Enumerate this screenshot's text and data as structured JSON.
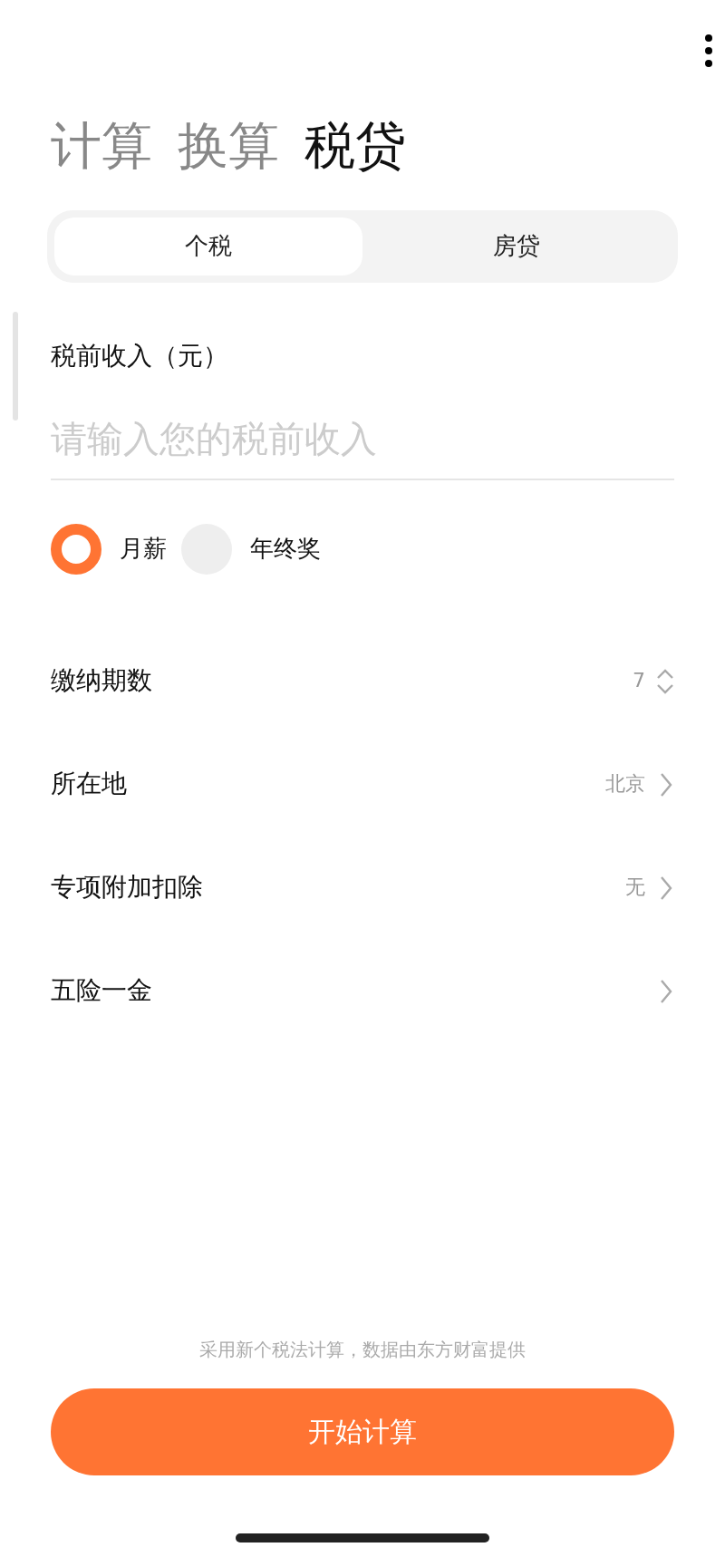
{
  "top_tabs": [
    {
      "label": "计算",
      "selected": false
    },
    {
      "label": "换算",
      "selected": false
    },
    {
      "label": "税贷",
      "selected": true
    }
  ],
  "segments": [
    {
      "label": "个税",
      "selected": true
    },
    {
      "label": "房贷",
      "selected": false
    }
  ],
  "income": {
    "label": "税前收入（元）",
    "placeholder": "请输入您的税前收入"
  },
  "income_type": [
    {
      "label": "月薪",
      "selected": true
    },
    {
      "label": "年终奖",
      "selected": false
    }
  ],
  "rows": [
    {
      "label": "缴纳期数",
      "value": "7",
      "kind": "stepper"
    },
    {
      "label": "所在地",
      "value": "北京",
      "kind": "chevron"
    },
    {
      "label": "专项附加扣除",
      "value": "无",
      "kind": "chevron"
    },
    {
      "label": "五险一金",
      "kind": "chevron"
    }
  ],
  "footnote": "采用新个税法计算，数据由东方财富提供",
  "button": "开始计算"
}
